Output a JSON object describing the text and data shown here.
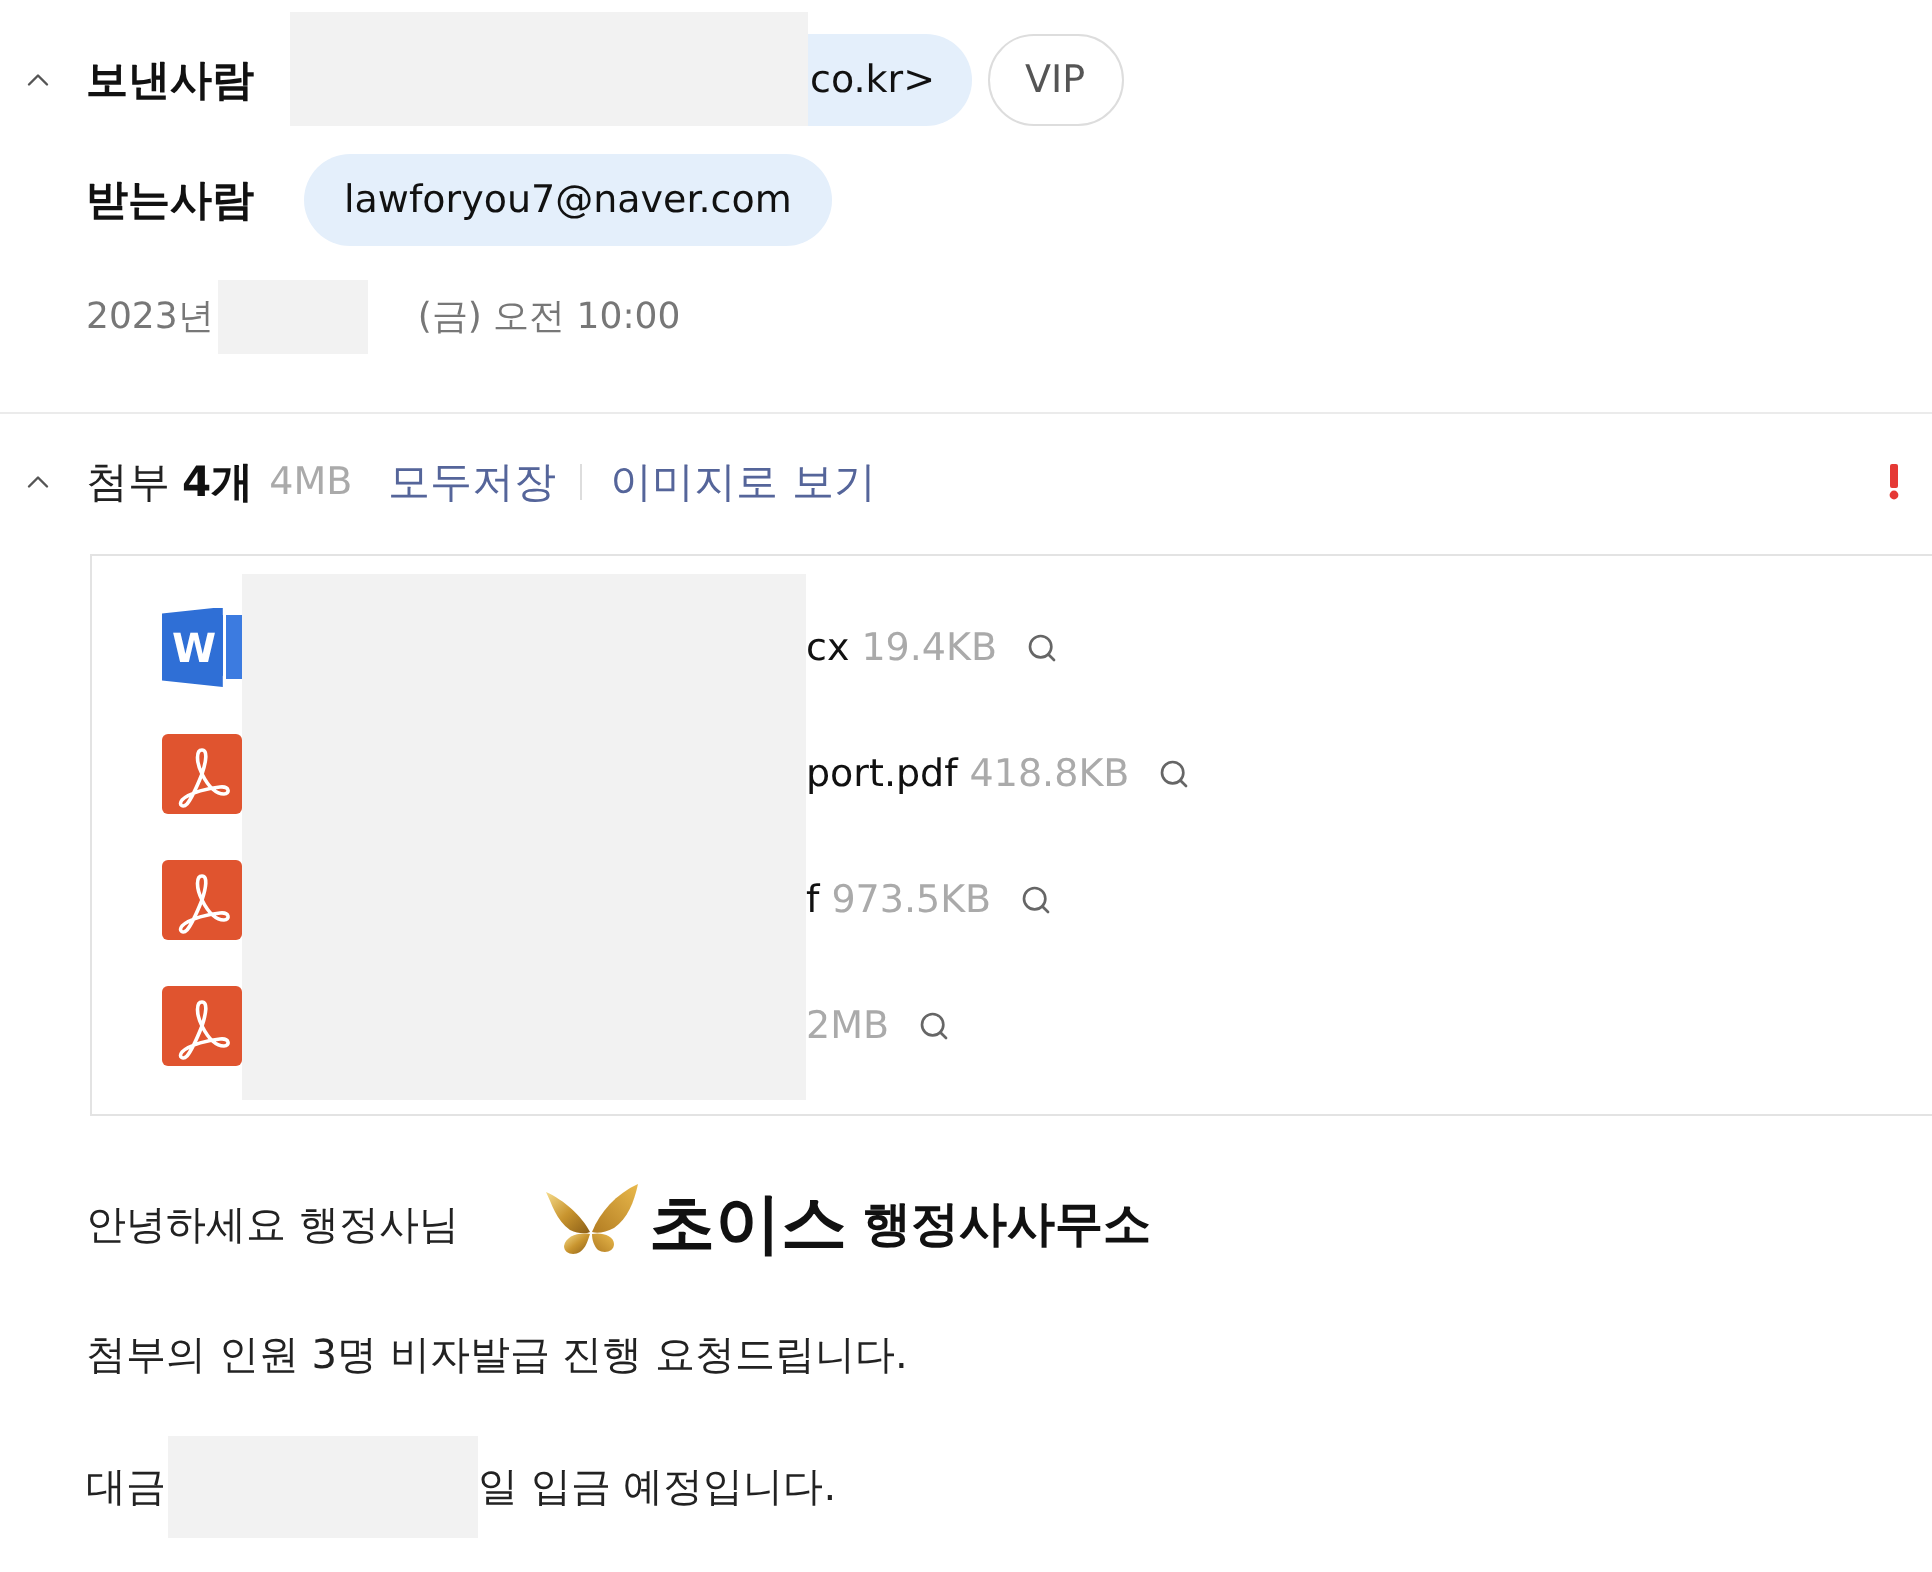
{
  "sender": {
    "label": "보낸사람",
    "address": "co.kr>",
    "badge": "VIP",
    "expanded": true
  },
  "recipient": {
    "label": "받는사람",
    "address": "lawforyou7@naver.com"
  },
  "date": {
    "parts": [
      "2023년",
      "(금) 오전 10:00"
    ]
  },
  "attachments": {
    "expanded": true,
    "label": "첨부",
    "count": "4개",
    "total_size": "4MB",
    "actions": [
      "모두저장",
      "이미지로 보기"
    ],
    "files": [
      {
        "kind": "word",
        "icon_text": "W",
        "name": "cx",
        "size": "19.4KB"
      },
      {
        "kind": "pdf",
        "name": "port.pdf",
        "size": "418.8KB"
      },
      {
        "kind": "pdf",
        "name": "f",
        "size": "973.5KB"
      },
      {
        "kind": "pdf",
        "size": "2MB"
      }
    ]
  },
  "body": {
    "greeting": "안녕하세요 행정사님",
    "logo": {
      "name": "초이스",
      "subtitle": "행정사사무소"
    },
    "paragraphs": [
      {
        "parts": [
          "첨부의 인원 3명 비자발급 진행 요청드립니다."
        ]
      },
      {
        "parts": [
          "대금",
          "일 입금 예정입니다."
        ]
      }
    ]
  }
}
